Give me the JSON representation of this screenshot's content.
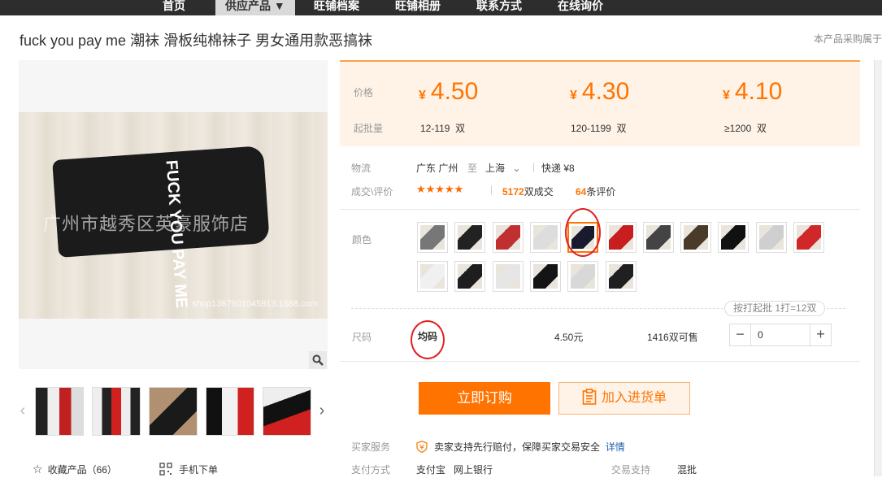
{
  "nav": {
    "items": [
      "首页",
      "供应产品 ▼",
      "旺铺档案",
      "旺铺相册",
      "联系方式",
      "在线询价"
    ]
  },
  "product": {
    "title": "fuck you pay me 潮袜 滑板纯棉袜子 男女通用款恶搞袜",
    "note": "本产品采购属于"
  },
  "image": {
    "sock_text": "FUCK YOU PAY ME",
    "watermark": "广州市越秀区英豪服饰店",
    "shop_url": "shop1367601045913.1688.com"
  },
  "actions": {
    "favorite_label": "收藏产品（66）",
    "mobile_label": "手机下单"
  },
  "pricing": {
    "price_label": "价格",
    "moq_label": "起批量",
    "currency": "¥",
    "tiers": [
      {
        "price": "4.50",
        "qty": "12-119",
        "unit": "双"
      },
      {
        "price": "4.30",
        "qty": "120-1199",
        "unit": "双"
      },
      {
        "price": "4.10",
        "qty": "≥1200",
        "unit": "双"
      }
    ]
  },
  "logistics": {
    "label": "物流",
    "from": "广东 广州",
    "to_word": "至",
    "to": "上海",
    "method": "快递 ¥8"
  },
  "deals": {
    "label": "成交\\评价",
    "stars": "★★★★★",
    "sold_count": "5172",
    "sold_suffix": "双成交",
    "review_count": "64",
    "review_suffix": "条评价"
  },
  "colors": {
    "label": "颜色",
    "swatches": [
      "#777777",
      "#222222",
      "#c03030",
      "#dddddd",
      "#1a1a2e",
      "#c81e1e",
      "#444444",
      "#4a3a2a",
      "#111111",
      "#cfcfcf",
      "#d02828",
      "#f0f0f0",
      "#1e1e1e",
      "#e6e6e6",
      "#141414",
      "#d8d8d8",
      "#202020"
    ],
    "selected_index": 4
  },
  "size": {
    "label": "尺码",
    "value": "均码",
    "price": "4.50元",
    "stock": "1416双可售",
    "quantity": "0",
    "batch_tip": "按打起批 1打=12双"
  },
  "buttons": {
    "buy": "立即订购",
    "cart": "加入进货单"
  },
  "service": {
    "label": "买家服务",
    "text": "卖家支持先行赔付，保障买家交易安全",
    "link": "详情"
  },
  "payment": {
    "label": "支付方式",
    "methods": [
      "支付宝",
      "网上银行"
    ],
    "trade_label": "交易支持",
    "trade_value": "混批"
  }
}
